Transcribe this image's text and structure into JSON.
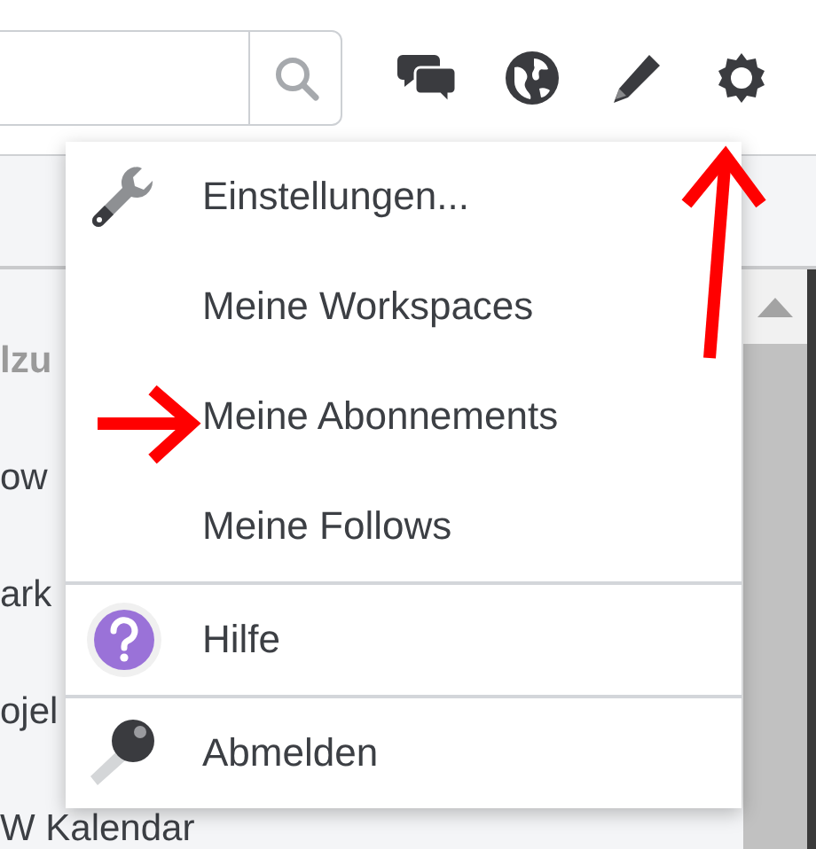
{
  "background_list": [
    {
      "text": "lzu",
      "kind": "heading"
    },
    {
      "text": "ow",
      "kind": "item"
    },
    {
      "text": "ark",
      "kind": "item"
    },
    {
      "text": "ojel",
      "kind": "item"
    },
    {
      "text": "W Kalendar",
      "kind": "item"
    }
  ],
  "menu": {
    "groups": [
      [
        {
          "label": "Einstellungen...",
          "kind": "settings"
        },
        {
          "label": "Meine Workspaces",
          "kind": "link"
        },
        {
          "label": "Meine Abonnements",
          "kind": "link"
        },
        {
          "label": "Meine Follows",
          "kind": "link"
        }
      ],
      [
        {
          "label": "Hilfe",
          "kind": "help"
        }
      ],
      [
        {
          "label": "Abmelden",
          "kind": "logout"
        }
      ]
    ]
  }
}
